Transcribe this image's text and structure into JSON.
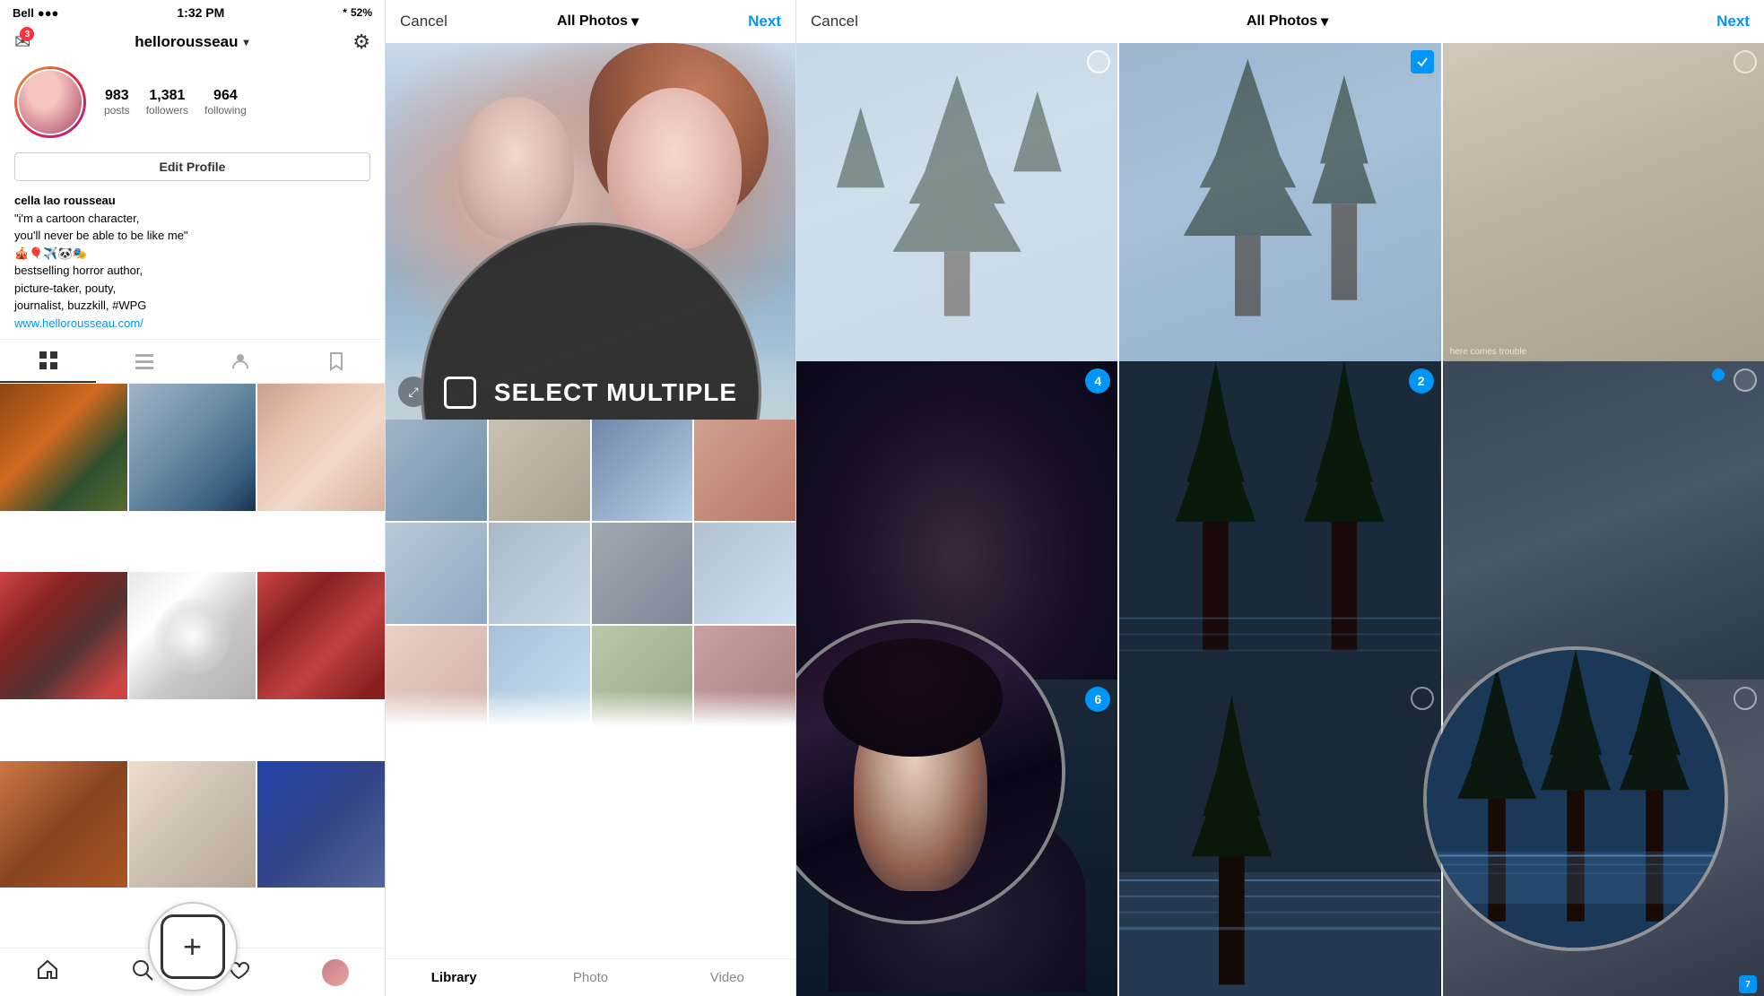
{
  "panel1": {
    "statusBar": {
      "carrier": "Bell",
      "time": "1:32 PM",
      "bluetooth": "🔷",
      "battery": "52%"
    },
    "username": "hellorousseau",
    "settingsIcon": "⚙",
    "stats": {
      "posts": {
        "count": "983",
        "label": "posts"
      },
      "followers": {
        "count": "1,381",
        "label": "followers"
      },
      "following": {
        "count": "964",
        "label": "following"
      }
    },
    "editProfileLabel": "Edit Profile",
    "bio": {
      "name": "cella lao rousseau",
      "line1": "\"i'm a cartoon character,",
      "line2": "you'll never be able to be like me\"",
      "emojis": "🎪🎈✈️🐼🎭",
      "line3": "bestselling horror author,",
      "line4": "picture-taker, pouty,",
      "line5": "journalist, buzzkill, #WPG",
      "link": "www.hellorousseau.com/"
    },
    "tabs": [
      "grid",
      "list",
      "person",
      "bookmark"
    ],
    "bottomNav": {
      "home": "🏠",
      "search": "🔍",
      "add": "+",
      "heart": "♡",
      "profile": "👤"
    }
  },
  "panel2": {
    "cancelLabel": "Cancel",
    "titleLabel": "All Photos",
    "nextLabel": "Next",
    "selectMultipleLabel": "SELECT MULTIPLE",
    "bottomTabs": [
      "Library",
      "Photo",
      "Video"
    ]
  },
  "panel3": {
    "cancelLabel": "Cancel",
    "titleLabel": "All Photos",
    "nextLabel": "Next",
    "badges": [
      4,
      2,
      6
    ],
    "textLabel": "here comes trouble"
  }
}
